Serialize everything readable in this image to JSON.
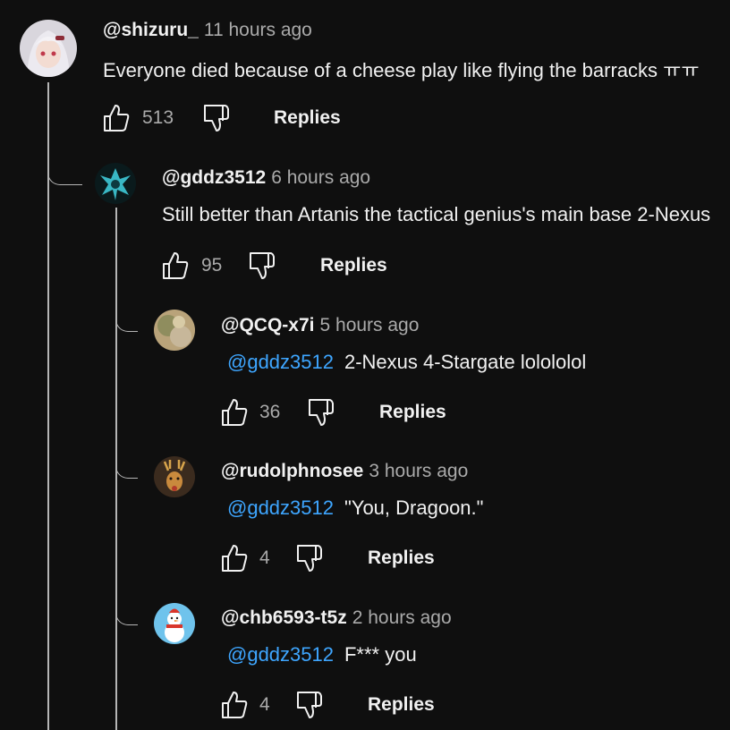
{
  "comments": [
    {
      "handle": "@shizuru_",
      "time": "11 hours ago",
      "mention": "",
      "text": "Everyone died because of a cheese play like flying the barracks ㅠㅠ",
      "likes": "513",
      "replies_label": "Replies",
      "avatar_icon": "anime-girl-avatar-icon"
    },
    {
      "handle": "@gddz3512",
      "time": "6 hours ago",
      "mention": "",
      "text": "Still better than Artanis the tactical genius's main base 2-Nexus",
      "likes": "95",
      "replies_label": "Replies",
      "avatar_icon": "crystal-creature-avatar-icon"
    },
    {
      "handle": "@QCQ-x7i",
      "time": "5 hours ago",
      "mention": "@gddz3512",
      "text": "2-Nexus 4-Stargate lolololol",
      "likes": "36",
      "replies_label": "Replies",
      "avatar_icon": "blurry-photo-avatar-icon"
    },
    {
      "handle": "@rudolphnosee",
      "time": "3 hours ago",
      "mention": "@gddz3512",
      "text": "\"You, Dragoon.\"",
      "likes": "4",
      "replies_label": "Replies",
      "avatar_icon": "deer-avatar-icon"
    },
    {
      "handle": "@chb6593-t5z",
      "time": "2 hours ago",
      "mention": "@gddz3512",
      "text": "F*** you",
      "likes": "4",
      "replies_label": "Replies",
      "avatar_icon": "snowman-avatar-icon"
    }
  ],
  "colors": {
    "background": "#0f0f0f",
    "text": "#f1f1f1",
    "secondary": "#aaaaaa",
    "mention": "#3ea6ff",
    "thread_line": "#b5b5b5"
  }
}
